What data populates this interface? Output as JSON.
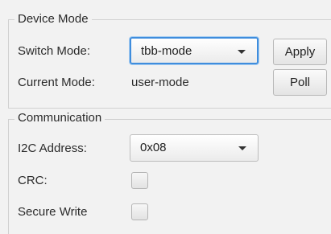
{
  "device_mode": {
    "section_title": "Device Mode",
    "switch_mode_label": "Switch Mode:",
    "switch_mode_value": "tbb-mode",
    "apply_label": "Apply",
    "current_mode_label": "Current Mode:",
    "current_mode_value": "user-mode",
    "poll_label": "Poll"
  },
  "communication": {
    "section_title": "Communication",
    "i2c_address_label": "I2C Address:",
    "i2c_address_value": "0x08",
    "crc_label": "CRC:",
    "crc_checked": false,
    "secure_write_label": "Secure Write",
    "secure_write_checked": false
  },
  "colors": {
    "focus_accent": "#3f8ddd",
    "background": "#f2f2f2"
  }
}
